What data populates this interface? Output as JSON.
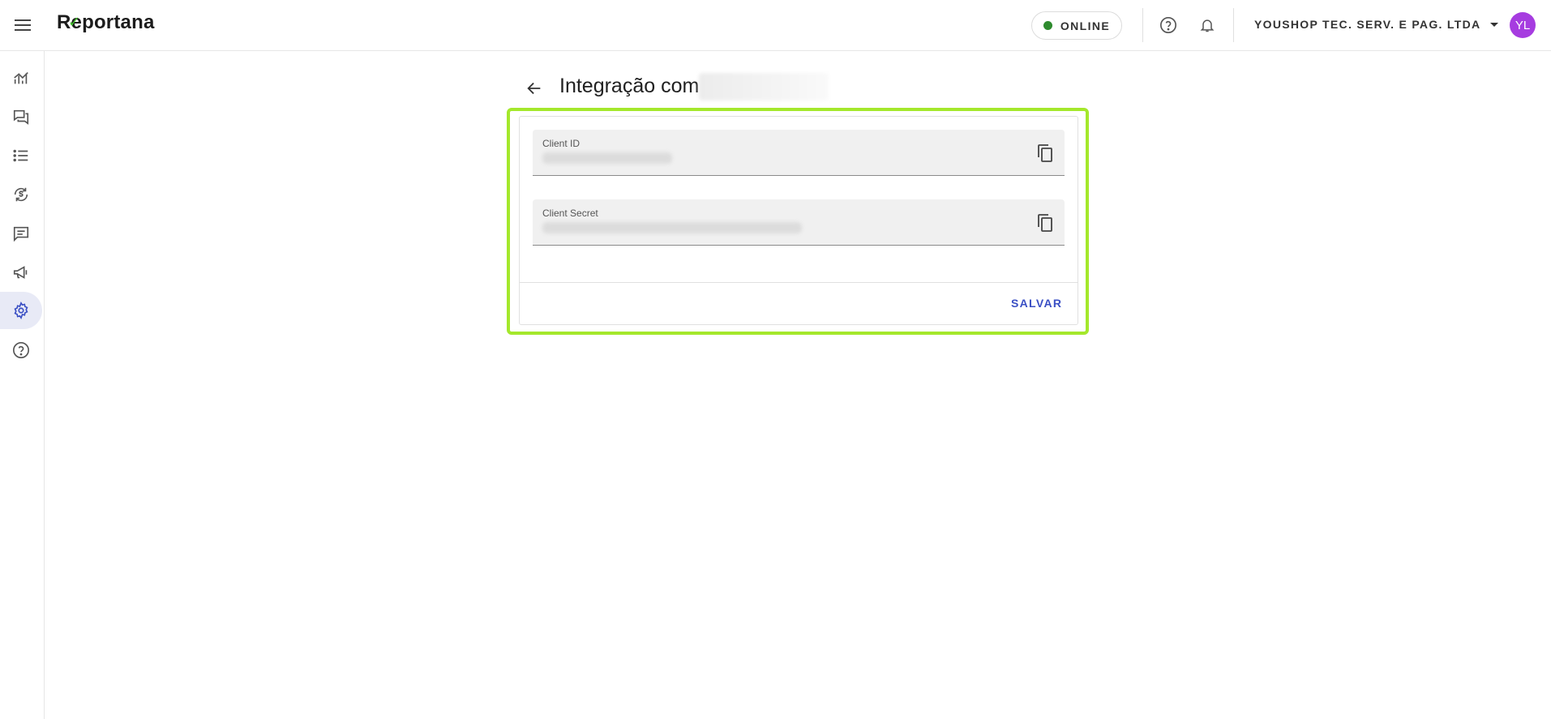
{
  "header": {
    "logo_text": "Reportana",
    "status_label": "ONLINE",
    "status_color": "#2e8b2e",
    "company_name": "YOUSHOP TEC. SERV. E PAG. LTDA",
    "avatar_initials": "YL",
    "avatar_color": "#a63ce0",
    "icons": [
      "menu-icon",
      "help-icon",
      "bell-icon",
      "caret-down-icon"
    ]
  },
  "sidebar": {
    "items": [
      {
        "icon": "analytics-icon"
      },
      {
        "icon": "chat-icon"
      },
      {
        "icon": "list-icon"
      },
      {
        "icon": "currency-sync-icon"
      },
      {
        "icon": "message-icon"
      },
      {
        "icon": "campaign-icon"
      },
      {
        "icon": "settings-icon",
        "active": true
      },
      {
        "icon": "help-icon"
      }
    ]
  },
  "main": {
    "title": "Integração com",
    "highlight_color": "#a4e82c",
    "fields": [
      {
        "label": "Client ID",
        "value": ""
      },
      {
        "label": "Client Secret",
        "value": ""
      }
    ],
    "save_label": "SALVAR"
  }
}
